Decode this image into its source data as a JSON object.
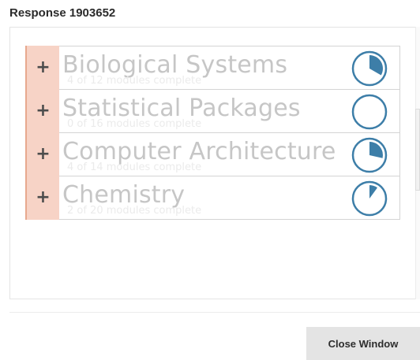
{
  "modal": {
    "title": "Response 1903652"
  },
  "modules": [
    {
      "title": "Biological Systems",
      "progress_text": "4 of 12 modules complete",
      "completed": 4,
      "total": 12
    },
    {
      "title": "Statistical Packages",
      "progress_text": "0 of 16 modules complete",
      "completed": 0,
      "total": 16
    },
    {
      "title": "Computer Architecture",
      "progress_text": "4 of 14 modules complete",
      "completed": 4,
      "total": 14
    },
    {
      "title": "Chemistry",
      "progress_text": "2 of 20 modules complete",
      "completed": 2,
      "total": 20
    }
  ],
  "icons": {
    "expand": "+",
    "expand_icon_name": "plus-icon",
    "progress_icon_name": "progress-ring-icon"
  },
  "footer": {
    "close_label": "Close Window"
  },
  "colors": {
    "accent": "#3d7ea8",
    "expand_tab": "#f7d3c6",
    "expand_tab_edge": "#e7a98f"
  }
}
